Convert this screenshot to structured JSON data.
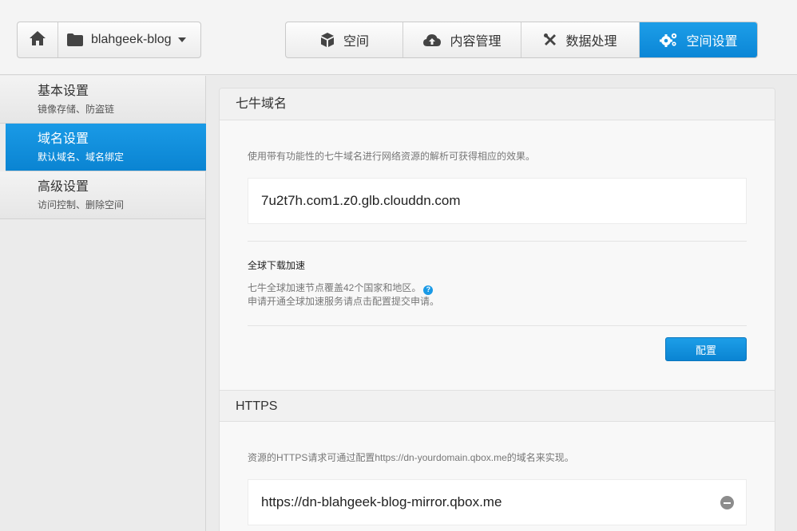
{
  "header": {
    "bucket_name": "blahgeek-blog",
    "tabs": [
      {
        "label": "空间",
        "icon": "box-icon"
      },
      {
        "label": "内容管理",
        "icon": "cloud-upload-icon"
      },
      {
        "label": "数据处理",
        "icon": "tools-icon"
      },
      {
        "label": "空间设置",
        "icon": "gears-icon",
        "active": true
      }
    ],
    "accent_color": "#1a9ae6"
  },
  "sidebar": {
    "items": [
      {
        "title": "基本设置",
        "subtitle": "镜像存储、防盗链"
      },
      {
        "title": "域名设置",
        "subtitle": "默认域名、域名绑定",
        "active": true
      },
      {
        "title": "高级设置",
        "subtitle": "访问控制、删除空间"
      }
    ]
  },
  "qiniu_domain": {
    "heading": "七牛域名",
    "description": "使用带有功能性的七牛域名进行网络资源的解析可获得相应的效果。",
    "domain": "7u2t7h.com1.z0.glb.clouddn.com",
    "accel_title": "全球下载加速",
    "accel_line1": "七牛全球加速节点覆盖42个国家和地区。",
    "accel_line2": "申请开通全球加速服务请点击配置提交申请。",
    "help_mark": "?",
    "config_button": "配置"
  },
  "https": {
    "heading": "HTTPS",
    "description": "资源的HTTPS请求可通过配置https://dn-yourdomain.qbox.me的域名来实现。",
    "domain": "https://dn-blahgeek-blog-mirror.qbox.me"
  }
}
